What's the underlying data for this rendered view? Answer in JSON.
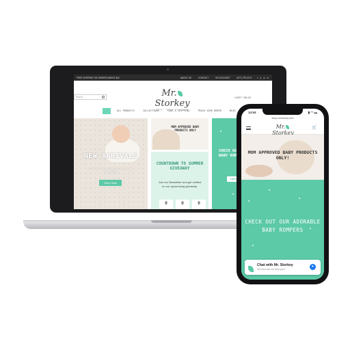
{
  "desktop": {
    "topbar": {
      "promo": "FREE SHIPPING ON ORDERS ABOVE $40",
      "links": [
        "ABOUT US",
        "CONTACT",
        "MY ACCOUNT"
      ],
      "phone": "(877) 279-0173",
      "social": "f ◎ p ✉"
    },
    "search_placeholder": "Search...",
    "logo": {
      "name_left": "Mr.",
      "name_right": "Storkey",
      "tagline": "BABY SHOP & GIFTS"
    },
    "cart_label": "CART / $0.00",
    "nav": [
      "ALL PRODUCTS",
      "COLLECTIONS",
      "FAQS & SHIPPING",
      "TRACK YOUR ORDER",
      "BLOG"
    ],
    "arrivals": {
      "title": "NEW ARRIVALS",
      "text": "Our super soft baby crib sheets are back online",
      "button": "Shop Now"
    },
    "mom_panel": {
      "text": "MOM APPROVED BABY PRODUCTS ONLY"
    },
    "countdown": {
      "title": "COUNTDOWN TO SUMMER GIVEAWAY",
      "text": "Join our Newsletter and get notified on our upcomming giveaway.",
      "values": [
        "0",
        "0",
        "0"
      ]
    },
    "rompers": {
      "text": "CHECK OUT OUR ADORABLE BABY ROMPERS",
      "button": "VIEW"
    }
  },
  "mobile": {
    "time": "14:54",
    "status_icons": "▮ ◠ ▬",
    "url": "shop.mrstorkey.com",
    "logo": {
      "name_left": "Mr.",
      "name_right": "Storkey"
    },
    "cart_icon": "cart-icon",
    "mom_text": "MOM APPROVED BABY PRODUCTS ONLY!",
    "rompers_text": "CHECK OUT OUR ADORABLE BABY ROMPERS",
    "chat": {
      "title": "Chat with Mr. Storkey",
      "subtitle": "Hi! How can we help you?"
    }
  },
  "colors": {
    "mint": "#5cc9a7",
    "mint_light": "#dcf3ea",
    "dark": "#1c1c1e"
  }
}
